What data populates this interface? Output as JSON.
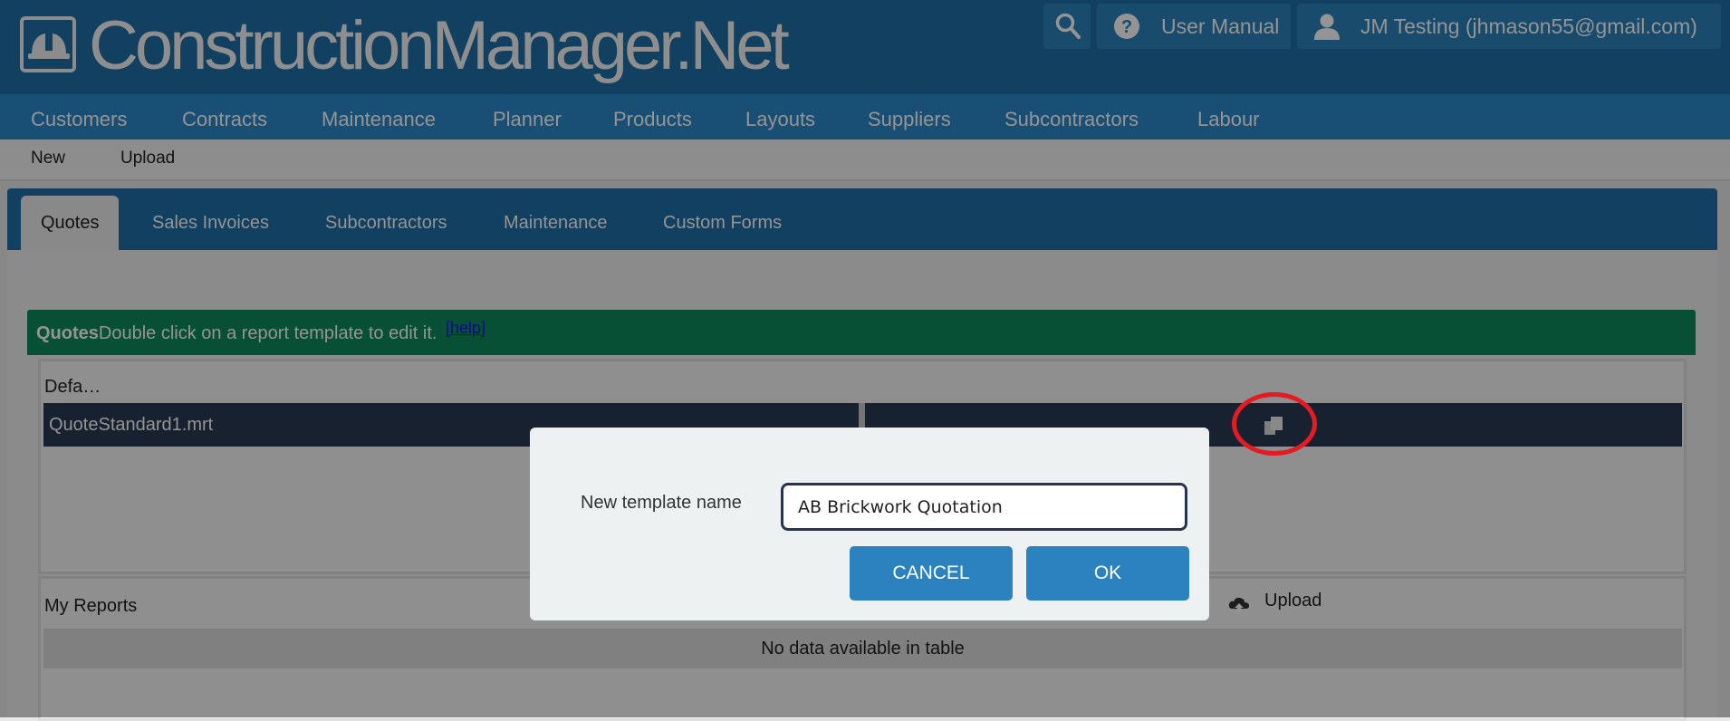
{
  "header": {
    "app_name": "ConstructionManager.Net",
    "logo_icon": "hardhat-icon",
    "search_icon": "search-icon",
    "user_manual_label": "User Manual",
    "user_label": "JM Testing (jhmason55@gmail.com)"
  },
  "main_nav": {
    "items": [
      "Customers",
      "Contracts",
      "Maintenance",
      "Planner",
      "Products",
      "Layouts",
      "Suppliers",
      "Subcontractors",
      "Labour"
    ]
  },
  "sub_nav": {
    "items": [
      "New",
      "Upload"
    ]
  },
  "tabs": {
    "items": [
      "Quotes",
      "Sales Invoices",
      "Subcontractors",
      "Maintenance",
      "Custom Forms"
    ],
    "active": "Quotes"
  },
  "banner": {
    "title": "Quotes",
    "text": "Double click on a report template to edit it.",
    "help_link": "[help]"
  },
  "default_panel": {
    "title": "Defa…",
    "rows": [
      {
        "name": "QuoteStandard1.mrt",
        "action_icon": "copy-icon"
      }
    ]
  },
  "my_reports_panel": {
    "title": "My Reports",
    "upload_label": "Upload",
    "empty_message": "No data available in table"
  },
  "dialog": {
    "label": "New template name",
    "input_value": "AB Brickwork Quotation",
    "cancel_label": "CANCEL",
    "ok_label": "OK"
  },
  "colors": {
    "header_bg": "#1f6fa6",
    "nav_bg": "#2b88c8",
    "banner_bg": "#0f8a5c",
    "button_bg": "#2b82be",
    "highlight_circle": "#e41b22"
  }
}
